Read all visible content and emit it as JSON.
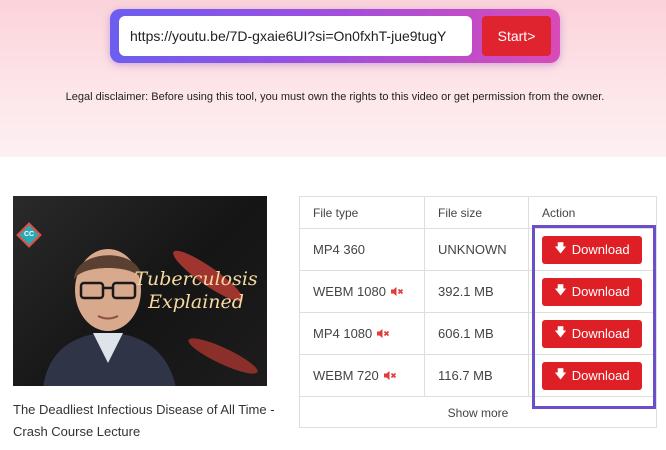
{
  "search": {
    "url_value": "https://youtu.be/7D-gxaie6UI?si=On0fxhT-jue9tugY",
    "start_label": "Start>"
  },
  "disclaimer": "Legal disclaimer: Before using this tool, you must own the rights to this video or get permission from the owner.",
  "video": {
    "thumbnail_badge": "CC",
    "thumbnail_title_line1": "Tuberculosis",
    "thumbnail_title_line2": "Explained",
    "title": "The Deadliest Infectious Disease of All Time - Crash Course Lecture"
  },
  "table": {
    "headers": [
      "File type",
      "File size",
      "Action"
    ],
    "rows": [
      {
        "type": "MP4 360",
        "muted": false,
        "size": "UNKNOWN",
        "action": "Download"
      },
      {
        "type": "WEBM 1080",
        "muted": true,
        "size": "392.1 MB",
        "action": "Download"
      },
      {
        "type": "MP4 1080",
        "muted": true,
        "size": "606.1 MB",
        "action": "Download"
      },
      {
        "type": "WEBM 720",
        "muted": true,
        "size": "116.7 MB",
        "action": "Download"
      }
    ],
    "show_more": "Show more"
  },
  "icons": {
    "download": "down-arrow-icon",
    "mute": "speaker-muted-icon"
  },
  "colors": {
    "accent_red": "#df1f26",
    "gradient_start": "#6b5ef0",
    "gradient_end": "#d84bb8",
    "highlight": "#6a4fc8"
  }
}
